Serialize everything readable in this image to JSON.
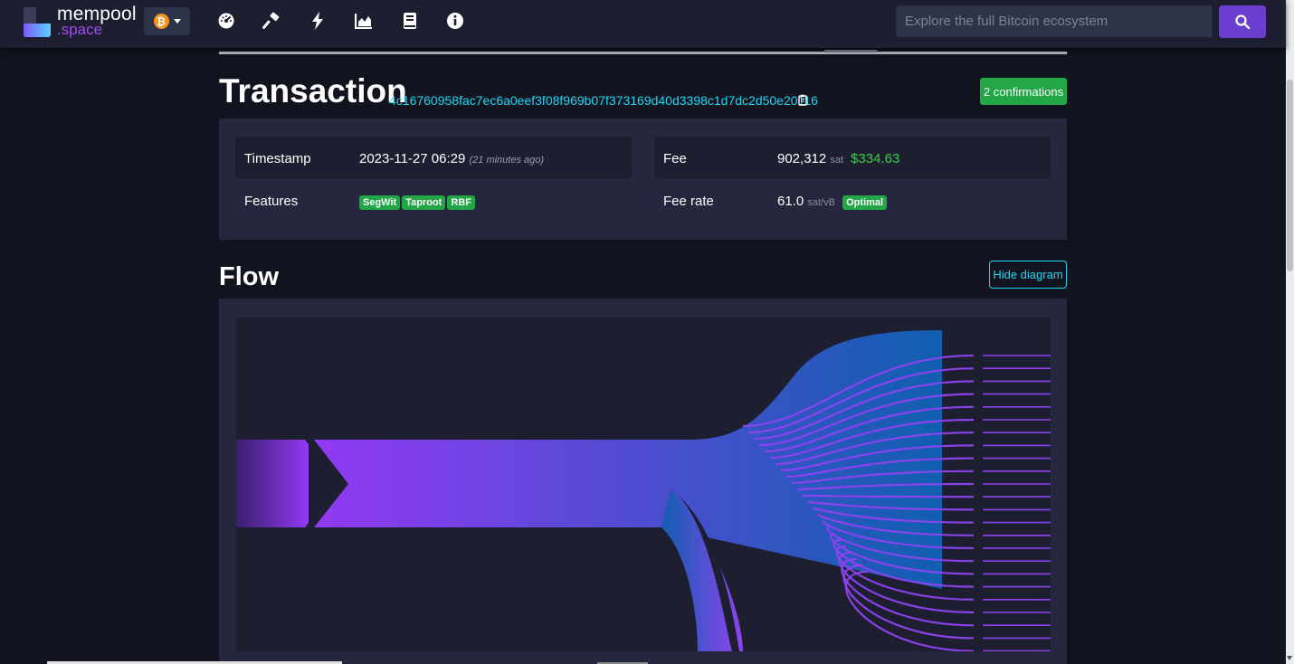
{
  "brand": {
    "line1": "mempool",
    "line2": ".space"
  },
  "network": {
    "icon": "bitcoin-icon",
    "symbol": "₿"
  },
  "nav": [
    {
      "name": "dashboard",
      "icon": "dashboard-icon"
    },
    {
      "name": "mining",
      "icon": "hammer-icon"
    },
    {
      "name": "lightning",
      "icon": "lightning-icon"
    },
    {
      "name": "graphs",
      "icon": "chart-icon"
    },
    {
      "name": "docs",
      "icon": "book-icon"
    },
    {
      "name": "about",
      "icon": "info-icon"
    }
  ],
  "search": {
    "placeholder": "Explore the full Bitcoin ecosystem",
    "button_icon": "search-icon"
  },
  "transaction": {
    "title": "Transaction",
    "txid": "4c16760958fac7ec6a0eef3f08f969b07f373169d40d3398c1d7dc2d50e20116",
    "confirmations": "2 confirmations",
    "timestamp_label": "Timestamp",
    "timestamp_value": "2023-11-27 06:29",
    "timestamp_ago": "(21 minutes ago)",
    "features_label": "Features",
    "features": [
      "SegWit",
      "Taproot",
      "RBF"
    ],
    "fee_label": "Fee",
    "fee_value": "902,312",
    "fee_unit": "sat",
    "fee_usd": "$334.63",
    "feerate_label": "Fee rate",
    "feerate_value": "61.0",
    "feerate_unit": "sat/vB",
    "feerate_badge": "Optimal"
  },
  "flow": {
    "title": "Flow",
    "toggle_label": "Hide diagram",
    "input_count": 1,
    "output_count": 24,
    "colors": {
      "input": "#9339f4",
      "mid": "#105fb0",
      "output": "#8f42f0"
    }
  }
}
